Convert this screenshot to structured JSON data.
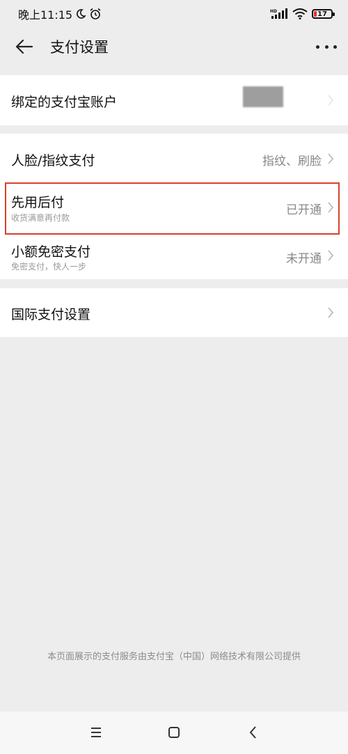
{
  "status_bar": {
    "time": "晚上11:15",
    "network_label": "HD",
    "battery_level": "17",
    "icons": [
      "moon-icon",
      "alarm-icon",
      "signal-icon",
      "wifi-icon",
      "battery-icon"
    ],
    "battery_color": "#e0332a"
  },
  "header": {
    "title": "支付设置",
    "icons": [
      "back-arrow-icon",
      "more-icon"
    ]
  },
  "sections": [
    {
      "items": [
        {
          "title": "绑定的支付宝账户",
          "value": "",
          "value_obscured": true
        }
      ]
    },
    {
      "items": [
        {
          "title": "人脸/指纹支付",
          "value": "指纹、刷脸"
        },
        {
          "title": "先用后付",
          "subtitle": "收货满意再付款",
          "value": "已开通",
          "highlighted": true
        },
        {
          "title": "小额免密支付",
          "subtitle": "免密支付，快人一步",
          "value": "未开通"
        }
      ]
    },
    {
      "items": [
        {
          "title": "国际支付设置",
          "value": ""
        }
      ]
    }
  ],
  "footer": {
    "text": "本页面展示的支付服务由支付宝（中国）网络技术有限公司提供"
  },
  "system_nav": {
    "icons": [
      "menu-icon",
      "home-square-icon",
      "back-chevron-icon"
    ]
  },
  "colors": {
    "highlight_border": "#d9412a",
    "background": "#ededed"
  }
}
